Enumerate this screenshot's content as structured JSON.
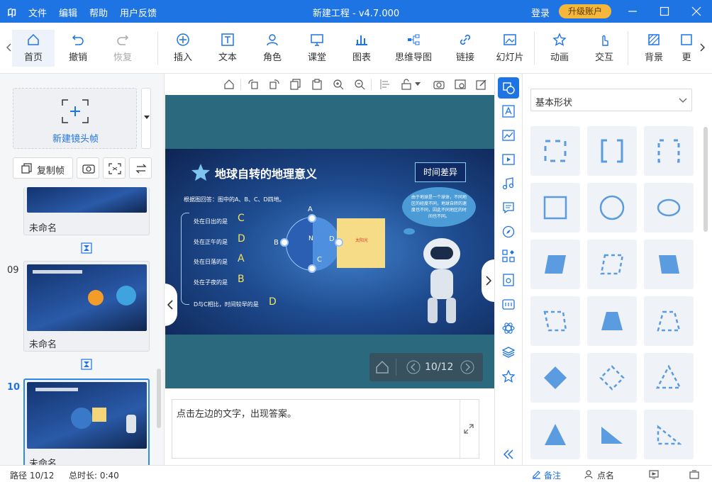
{
  "titlebar": {
    "logo": "卬",
    "menu": [
      "文件",
      "编辑",
      "帮助",
      "用户反馈"
    ],
    "title": "新建工程 - v4.7.000",
    "login": "登录",
    "upgrade": "升级账户"
  },
  "toolbar": {
    "home": "首页",
    "undo": "撤销",
    "redo": "恢复",
    "insert": "插入",
    "text": "文本",
    "role": "角色",
    "classroom": "课堂",
    "chart": "图表",
    "mindmap": "思维导图",
    "link": "链接",
    "slideshow": "幻灯片",
    "animation": "动画",
    "interact": "交互",
    "background": "背景",
    "more": "更"
  },
  "left": {
    "new_frame": "新建镜头帧",
    "copy_frame": "复制帧",
    "frames": [
      {
        "num": "",
        "name": "未命名"
      },
      {
        "num": "09",
        "name": "未命名"
      },
      {
        "num": "10",
        "name": "未命名"
      }
    ]
  },
  "slide": {
    "title": "地球自转的地理意义",
    "time_diff": "时间差异",
    "prompt": "根据图回答：图中的A、B、C、D四地。",
    "questions": [
      "处在日出的是",
      "处在正午的是",
      "处在日落的是",
      "处在子夜的是",
      "D与C相比，时间较早的是"
    ],
    "answers": [
      "C",
      "D",
      "A",
      "B",
      "D"
    ],
    "bubble": "由于地球是一个球体，不同地区的经度不同，地球自转的速度也不同，因此不同地区的时间也不同。",
    "sun": "太阳光",
    "labels": [
      "A",
      "B",
      "N",
      "D",
      "C"
    ]
  },
  "canvas": {
    "page": "10/12"
  },
  "notes": {
    "text": "点击左边的文字，出现答案。"
  },
  "shapes": {
    "dropdown": "基本形状"
  },
  "status": {
    "path": "路径 10/12",
    "duration": "总时长: 0:40",
    "notes_tab": "备注",
    "rollcall": "点名"
  },
  "colors": {
    "accent": "#1f74e4",
    "upgrade": "#f5b63c",
    "shape": "#5b9be0"
  }
}
